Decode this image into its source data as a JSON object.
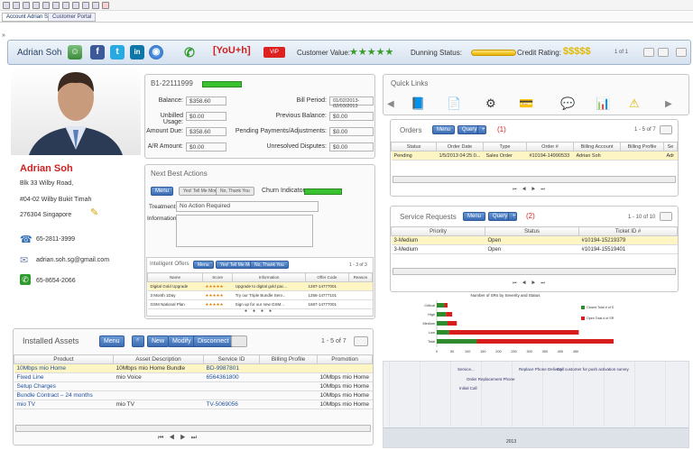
{
  "tabs": [
    "Account Adrian Soh",
    "Customer Portal"
  ],
  "header": {
    "name": "Adrian Soh",
    "brand": "[YoU+h]",
    "vip": "VIP",
    "customer_value_label": "Customer Value:",
    "customer_value_stars": "★★★★★",
    "dunning_label": "Dunning Status:",
    "credit_label": "Credit Rating:",
    "credit_rating": "$$$$$",
    "pager": "1 of 1",
    "icons": [
      "contacts-icon",
      "facebook-icon",
      "twitter-icon",
      "linkedin-icon",
      "globe-icon",
      "phone-icon"
    ]
  },
  "profile": {
    "name": "Adrian Soh",
    "address": [
      "Blk 33 Wilby Road,",
      "#04-02 Wilby Bukit Timah",
      "276304 Singapore"
    ],
    "phone": "65-2811-3999",
    "email": "adrian.soh.sg@gmail.com",
    "mobile": "65-8654-2066"
  },
  "billing": {
    "account": "B1-22111999",
    "left": [
      {
        "label": "Balance:",
        "value": "$358.60"
      },
      {
        "label": "Unbilled Usage:",
        "value": "$0.00"
      },
      {
        "label": "Amount Due:",
        "value": "$358.60"
      },
      {
        "label": "A/R Amount:",
        "value": "$0.00"
      }
    ],
    "right": [
      {
        "label": "Bill Period:",
        "value": "01/02/2013-02/03/2013"
      },
      {
        "label": "Previous Balance:",
        "value": "$0.00"
      },
      {
        "label": "Pending Payments/Adjustments:",
        "value": "$0.00"
      },
      {
        "label": "Unresolved Disputes:",
        "value": "$0.00"
      }
    ]
  },
  "nba": {
    "title": "Next Best Actions",
    "menu": "Menu",
    "tell_more": "Yes! Tell Me More",
    "no_thanks": "No, Thank You",
    "churn_label": "Churn Indicator:",
    "treatment_label": "Treatment:",
    "treatment_value": "No Action Required",
    "information_label": "Information:",
    "offers_title": "Intelligent Offers",
    "offers_pager": "1 - 3 of 3",
    "offer_headers": [
      "Name",
      "Score",
      "Information",
      "Offer Code",
      "Reason"
    ],
    "offers": [
      {
        "name": "Digital Gold Upgrade",
        "score": "★★★★★",
        "info": "Upgrade to digital gold pac...",
        "code": "1287-14777001",
        "reason": ""
      },
      {
        "name": "3 Month 1Day",
        "score": "★★★★★",
        "info": "Try our Triple Bundle Serv...",
        "code": "1256-14777101",
        "reason": ""
      },
      {
        "name": "GSM National Plan",
        "score": "★★★★★",
        "info": "Sign up for our new GSM...",
        "code": "1687-14777001",
        "reason": ""
      }
    ]
  },
  "quick_links": {
    "title": "Quick Links",
    "icons": [
      "book-icon",
      "document-icon",
      "gear-icon",
      "payment-card-icon",
      "chat-icon",
      "bar-chart-icon",
      "warning-icon"
    ]
  },
  "orders": {
    "title": "Orders",
    "menu": "Menu",
    "query": "Query",
    "count": "(1)",
    "pager": "1 - 5 of 7",
    "headers": [
      "Status",
      "Order Date",
      "Type",
      "Order #",
      "Billing Account",
      "Billing Profile",
      "Se"
    ],
    "rows": [
      [
        "Pending",
        "1/5/2013 04:25:0...",
        "Sales Order",
        "#10194-14990533",
        "Adrian Soh",
        "",
        "Adr"
      ]
    ]
  },
  "service_requests": {
    "title": "Service Requests",
    "menu": "Menu",
    "query": "Query",
    "count": "(2)",
    "pager": "1 - 10 of 10",
    "headers": [
      "Priority",
      "Status",
      "Ticket ID #"
    ],
    "rows": [
      [
        "3-Medium",
        "Open",
        "#10194-15219379"
      ],
      [
        "3-Medium",
        "Open",
        "#10194-15519401"
      ]
    ]
  },
  "assets": {
    "title": "Installed Assets",
    "menu": "Menu",
    "new": "New",
    "modify": "Modify",
    "disconnect": "Disconnect",
    "pager": "1 - 5 of 7",
    "headers": [
      "Product",
      "Asset Description",
      "Service ID",
      "Billing Profile",
      "Promotion"
    ],
    "rows": [
      [
        "10Mbps mio Home",
        "10Mbps mio Home Bundle",
        "BD-9987801",
        "",
        ""
      ],
      [
        "Fixed Line",
        "mio Voice",
        "6564361800",
        "",
        "10Mbps mio Home"
      ],
      [
        "Setup Charges",
        "",
        "",
        "",
        "10Mbps mio Home"
      ],
      [
        "Bundle Contract – 24 months",
        "",
        "",
        "",
        "10Mbps mio Home"
      ],
      [
        "mio TV",
        "mio TV",
        "TV-5069056",
        "",
        "10Mbps mio Home"
      ]
    ]
  },
  "chart_data": {
    "type": "bar",
    "title": "Number of SRs by Severity and Status",
    "categories": [
      "Critical",
      "High",
      "Medium",
      "Low",
      "Total"
    ],
    "series": [
      {
        "name": "Closed Total # of SRs",
        "values": [
          25,
          30,
          35,
          40,
          130
        ]
      },
      {
        "name": "Open Total # of SRs",
        "values": [
          10,
          20,
          30,
          420,
          480
        ]
      }
    ],
    "x_ticks": [
      "0",
      "50",
      "100",
      "150",
      "200",
      "250",
      "300",
      "350",
      "400",
      "450"
    ],
    "xlim": [
      0,
      450
    ],
    "colors": {
      "closed": "#2e8b2e",
      "open": "#d81d1d"
    }
  },
  "timeline": {
    "events": [
      "Service...",
      "Replace Phone Delivery",
      "Call customer for push activation survey",
      "Order Replacement Phone",
      "Initial Call"
    ],
    "year": "2013"
  },
  "colors": {
    "accent": "#3c6db3",
    "header_bg": "#dbe6f1",
    "highlight": "#fdf5c4",
    "name_red": "#d02020",
    "green": "#39c12f",
    "vip_red": "#d22"
  }
}
